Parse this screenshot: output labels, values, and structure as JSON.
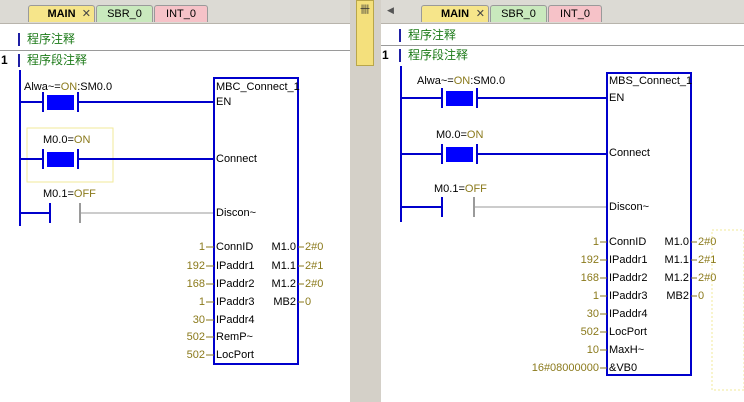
{
  "tabs": [
    {
      "label": "MAIN",
      "closable": true
    },
    {
      "label": "SBR_0"
    },
    {
      "label": "INT_0"
    }
  ],
  "left": {
    "program_comment": "程序注释",
    "network": {
      "number": "1",
      "comment": "程序段注释"
    },
    "contacts": [
      {
        "label_a": "Alwa~",
        "label_eq": "=",
        "label_on": "ON",
        "label_b": ":SM0.0",
        "state": "on"
      },
      {
        "label_a": "M0.0",
        "label_eq": "=",
        "label_on": "ON",
        "state": "on"
      },
      {
        "label_a": "M0.1",
        "label_eq": "=",
        "label_on": "OFF",
        "state": "off"
      }
    ],
    "block": {
      "title": "MBC_Connect_1",
      "bool_pins": [
        "EN",
        "Connect",
        "Discon~"
      ],
      "inputs": [
        {
          "value": "1",
          "name": "ConnID"
        },
        {
          "value": "192",
          "name": "IPaddr1"
        },
        {
          "value": "168",
          "name": "IPaddr2"
        },
        {
          "value": "1",
          "name": "IPaddr3"
        },
        {
          "value": "30",
          "name": "IPaddr4"
        },
        {
          "value": "502",
          "name": "RemP~"
        },
        {
          "value": "502",
          "name": "LocPort"
        }
      ],
      "outputs": [
        {
          "name": "M1.0",
          "value": "2#0"
        },
        {
          "name": "M1.1",
          "value": "2#1"
        },
        {
          "name": "M1.2",
          "value": "2#0"
        },
        {
          "name": "MB2",
          "value": "0"
        }
      ]
    }
  },
  "right": {
    "program_comment": "程序注释",
    "network": {
      "number": "1",
      "comment": "程序段注释"
    },
    "contacts": [
      {
        "label_a": "Alwa~",
        "label_eq": "=",
        "label_on": "ON",
        "label_b": ":SM0.0",
        "state": "on"
      },
      {
        "label_a": "M0.0",
        "label_eq": "=",
        "label_on": "ON",
        "state": "on"
      },
      {
        "label_a": "M0.1",
        "label_eq": "=",
        "label_on": "OFF",
        "state": "off"
      }
    ],
    "block": {
      "title": "MBS_Connect_1",
      "bool_pins": [
        "EN",
        "Connect",
        "Discon~"
      ],
      "inputs": [
        {
          "value": "1",
          "name": "ConnID"
        },
        {
          "value": "192",
          "name": "IPaddr1"
        },
        {
          "value": "168",
          "name": "IPaddr2"
        },
        {
          "value": "1",
          "name": "IPaddr3"
        },
        {
          "value": "30",
          "name": "IPaddr4"
        },
        {
          "value": "502",
          "name": "LocPort"
        },
        {
          "value": "10",
          "name": "MaxH~"
        },
        {
          "value": "16#08000000",
          "name": "&VB0"
        }
      ],
      "outputs": [
        {
          "name": "M1.0",
          "value": "2#0"
        },
        {
          "name": "M1.1",
          "value": "2#1"
        },
        {
          "name": "M1.2",
          "value": "2#0"
        },
        {
          "name": "MB2",
          "value": "0"
        }
      ]
    }
  },
  "splitter": {
    "grip_text": "卌"
  },
  "colors": {
    "power": "#0000cc",
    "energized": "#0000ff",
    "inactive": "#9a9a9a",
    "comment": "#1c7a18",
    "value": "#8b7a1c",
    "selection": "#f2ea9a"
  }
}
